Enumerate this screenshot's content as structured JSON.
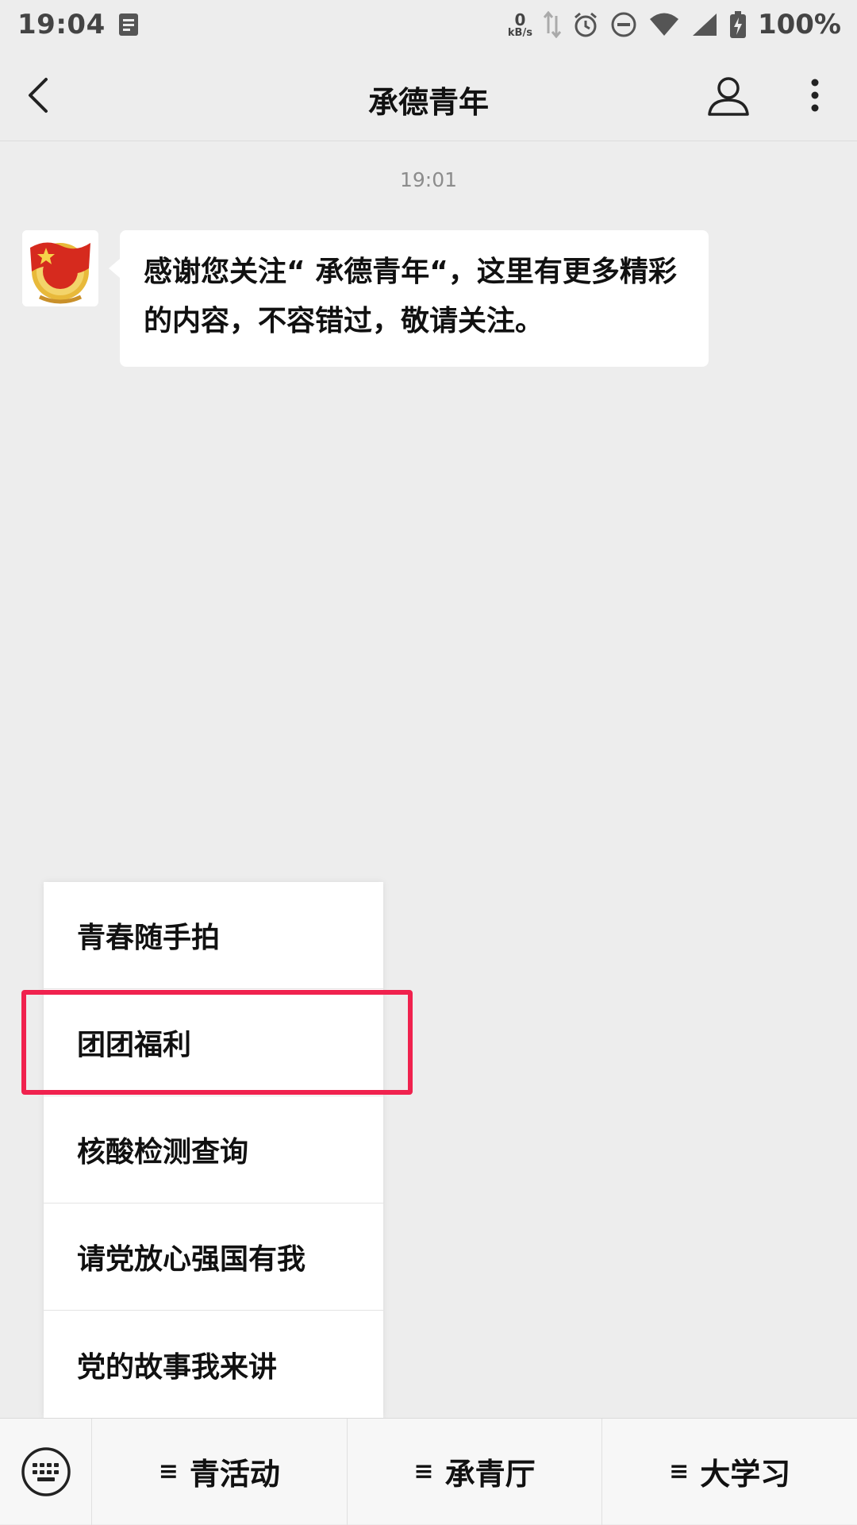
{
  "status_bar": {
    "time": "19:04",
    "net_speed_value": "0",
    "net_speed_unit": "kB/s",
    "battery_text": "100%"
  },
  "nav": {
    "title": "承德青年"
  },
  "chat": {
    "timestamp": "19:01",
    "message": "感谢您关注“ 承德青年“，这里有更多精彩的内容，不容错过，敬请关注。"
  },
  "popup_menu": {
    "items": [
      {
        "label": "青春随手拍"
      },
      {
        "label": "团团福利"
      },
      {
        "label": "核酸检测查询"
      },
      {
        "label": "请党放心强国有我"
      },
      {
        "label": "党的故事我来讲"
      }
    ],
    "highlighted_index": 1,
    "highlight_color": "#f0224e"
  },
  "bottom_bar": {
    "menu_glyph": "≡",
    "tabs": [
      {
        "label": "青活动"
      },
      {
        "label": "承青厅"
      },
      {
        "label": "大学习"
      }
    ]
  },
  "colors": {
    "background": "#ededed",
    "bubble": "#ffffff"
  }
}
